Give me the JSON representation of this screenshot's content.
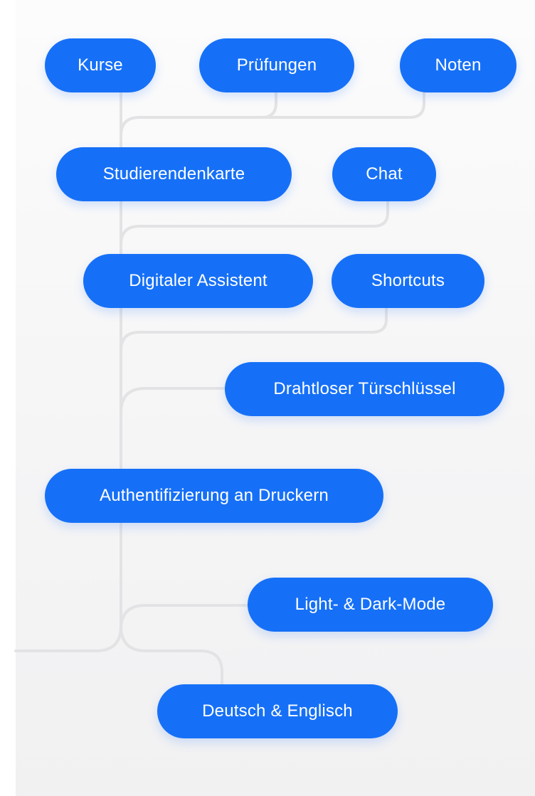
{
  "colors": {
    "pill_background": "#1670F7",
    "pill_text": "#FFFFFF",
    "connector_line": "#E3E3E5",
    "background": "#F5F5F6"
  },
  "features": [
    {
      "key": "kurse",
      "label": "Kurse"
    },
    {
      "key": "pruefungen",
      "label": "Prüfungen"
    },
    {
      "key": "noten",
      "label": "Noten"
    },
    {
      "key": "studierendenkarte",
      "label": "Studierendenkarte"
    },
    {
      "key": "chat",
      "label": "Chat"
    },
    {
      "key": "digitaler-assistent",
      "label": "Digitaler Assistent"
    },
    {
      "key": "shortcuts",
      "label": "Shortcuts"
    },
    {
      "key": "drahtloser-tuerschluessel",
      "label": "Drahtloser Türschlüssel"
    },
    {
      "key": "authentifizierung",
      "label": "Authentifizierung an Druckern"
    },
    {
      "key": "light-dark-mode",
      "label": "Light- & Dark-Mode"
    },
    {
      "key": "deutsch-englisch",
      "label": "Deutsch & Englisch"
    }
  ]
}
